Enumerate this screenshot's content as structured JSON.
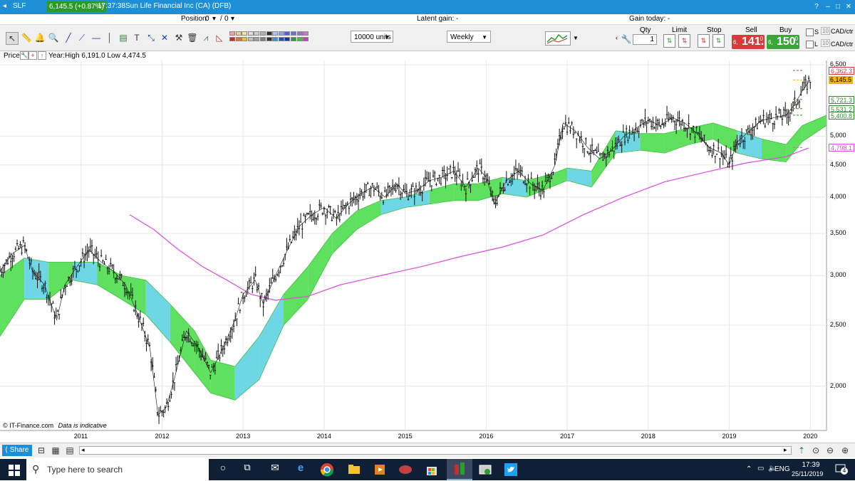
{
  "titlebar": {
    "symbol": "SLF",
    "price_change": "6,145.5 (+0.87%)",
    "time": "17:37:38",
    "instrument": "Sun Life Financial Inc (CA) (DFB)"
  },
  "info": {
    "position_label": "Position:",
    "position_value": "0",
    "position_sep": "/",
    "position_value2": "0",
    "latent_gain": "Latent gain: -",
    "gain_today": "Gain today: -"
  },
  "toolbar": {
    "units": "10000 units",
    "period": "Weekly",
    "qty_label": "Qty",
    "qty_value": "1",
    "limit_label": "Limit",
    "stop_label": "Stop",
    "sell_label": "Sell",
    "buy_label": "Buy",
    "sell_small": "6,",
    "sell_big": "141.",
    "sell_sup": "0",
    "buy_small": "6,",
    "buy_big": "150.",
    "buy_sup": "0",
    "s_label": "S",
    "l_label": "L",
    "s_qty": "10",
    "l_qty": "10",
    "ccy1": "CAD/ctr",
    "ccy2": "CAD/ctr",
    "icons": [
      "cursor-icon",
      "ruler-icon",
      "bell-icon",
      "zoom-icon",
      "line-tool-icon",
      "ray-tool-icon",
      "trend-icon",
      "vertical-line-icon",
      "horizontal-line-icon",
      "fibonacci-icon",
      "text-tool-icon",
      "arrow-tool-icon",
      "cross-tool-icon",
      "hammer-icon",
      "trash-icon",
      "pattern-tool-icon",
      "triangle-tool-icon"
    ],
    "swatches_row1": [
      "#f5a0a0",
      "#f7c5a0",
      "#f7e3a0",
      "#e0e0e0",
      "#d0d0d0",
      "#b0b0b0",
      "#303030",
      "#a0c8f0",
      "#90a0f0",
      "#5060e0",
      "#7070d0",
      "#a070d0",
      "#d070d0"
    ],
    "swatches_row2": [
      "#e02020",
      "#f07020",
      "#f0c020",
      "#c0c0c0",
      "#a0a0a0",
      "#808080",
      "#303030",
      "#4090e0",
      "#2050c0",
      "#2030a0",
      "#20a040",
      "#40c040",
      "#c040c0"
    ]
  },
  "pricelabel": {
    "title": "Price",
    "range": "Year:High 6,191.0 Low 4,474.5"
  },
  "chart_data": {
    "type": "line",
    "title": "Sun Life Financial Inc (CA) (DFB)",
    "interval": "Weekly",
    "log_scale": true,
    "grid": true,
    "ylim": [
      1700,
      6600
    ],
    "y_ticks": [
      "6,500",
      "5,000",
      "4,500",
      "4,000",
      "3,500",
      "3,000",
      "2,500",
      "2,000"
    ],
    "x_ticks": [
      "2011",
      "2012",
      "2013",
      "2014",
      "2015",
      "2016",
      "2017",
      "2018",
      "2019",
      "2020"
    ],
    "x_range": [
      2010.0,
      2020.2
    ],
    "colors": {
      "price": "#111111",
      "ma": "#e04be0",
      "cloud_bull": "#5fe05f",
      "cloud_bear": "#6fd6e6",
      "current": "#f4b400"
    },
    "price_labels": [
      {
        "text": "6,362.3",
        "value": 6362.3,
        "color": "#d63b3b"
      },
      {
        "text": "6,145.5",
        "value": 6145.5,
        "color": "#f4b400"
      },
      {
        "text": "5,721.3",
        "value": 5721.3,
        "color": "#2a8f2a"
      },
      {
        "text": "5,531.2",
        "value": 5531.2,
        "color": "#2a8f2a"
      },
      {
        "text": "5,400.8",
        "value": 5400.8,
        "color": "#2a8f2a"
      },
      {
        "text": "4,798.1",
        "value": 4798.1,
        "color": "#e04be0"
      }
    ],
    "series": [
      {
        "name": "Price",
        "points": [
          [
            2010.0,
            3050
          ],
          [
            2010.15,
            3250
          ],
          [
            2010.3,
            3350
          ],
          [
            2010.4,
            3050
          ],
          [
            2010.55,
            2900
          ],
          [
            2010.7,
            2550
          ],
          [
            2010.8,
            2900
          ],
          [
            2010.95,
            3100
          ],
          [
            2011.1,
            3300
          ],
          [
            2011.25,
            3150
          ],
          [
            2011.4,
            3050
          ],
          [
            2011.55,
            2900
          ],
          [
            2011.7,
            2600
          ],
          [
            2011.85,
            2300
          ],
          [
            2011.95,
            1800
          ],
          [
            2012.05,
            1850
          ],
          [
            2012.15,
            2050
          ],
          [
            2012.3,
            2450
          ],
          [
            2012.45,
            2300
          ],
          [
            2012.6,
            2100
          ],
          [
            2012.75,
            2300
          ],
          [
            2012.9,
            2550
          ],
          [
            2013.0,
            2800
          ],
          [
            2013.15,
            2950
          ],
          [
            2013.25,
            2700
          ],
          [
            2013.4,
            3000
          ],
          [
            2013.55,
            3300
          ],
          [
            2013.7,
            3600
          ],
          [
            2013.85,
            3750
          ],
          [
            2014.0,
            3850
          ],
          [
            2014.15,
            3700
          ],
          [
            2014.3,
            3900
          ],
          [
            2014.45,
            4050
          ],
          [
            2014.6,
            4150
          ],
          [
            2014.75,
            4000
          ],
          [
            2014.9,
            4200
          ],
          [
            2015.0,
            4050
          ],
          [
            2015.15,
            4100
          ],
          [
            2015.3,
            4250
          ],
          [
            2015.45,
            4300
          ],
          [
            2015.6,
            4400
          ],
          [
            2015.75,
            4150
          ],
          [
            2015.9,
            4450
          ],
          [
            2016.0,
            4300
          ],
          [
            2016.1,
            3900
          ],
          [
            2016.25,
            4250
          ],
          [
            2016.4,
            4400
          ],
          [
            2016.55,
            4200
          ],
          [
            2016.7,
            4100
          ],
          [
            2016.85,
            4500
          ],
          [
            2016.95,
            5250
          ],
          [
            2017.1,
            5100
          ],
          [
            2017.25,
            4800
          ],
          [
            2017.4,
            4600
          ],
          [
            2017.55,
            4750
          ],
          [
            2017.7,
            5000
          ],
          [
            2017.85,
            5150
          ],
          [
            2018.0,
            5300
          ],
          [
            2018.15,
            5200
          ],
          [
            2018.3,
            5350
          ],
          [
            2018.45,
            5250
          ],
          [
            2018.6,
            5050
          ],
          [
            2018.75,
            4800
          ],
          [
            2018.9,
            4700
          ],
          [
            2019.0,
            4500
          ],
          [
            2019.1,
            4900
          ],
          [
            2019.25,
            5100
          ],
          [
            2019.4,
            5300
          ],
          [
            2019.55,
            5350
          ],
          [
            2019.7,
            5400
          ],
          [
            2019.8,
            5600
          ],
          [
            2019.9,
            5900
          ],
          [
            2020.0,
            6150
          ]
        ]
      },
      {
        "name": "Moving average",
        "points": [
          [
            2011.6,
            3750
          ],
          [
            2011.9,
            3550
          ],
          [
            2012.2,
            3300
          ],
          [
            2012.5,
            3100
          ],
          [
            2012.8,
            2950
          ],
          [
            2013.1,
            2800
          ],
          [
            2013.4,
            2740
          ],
          [
            2013.8,
            2780
          ],
          [
            2014.2,
            2900
          ],
          [
            2014.7,
            3000
          ],
          [
            2015.2,
            3100
          ],
          [
            2015.7,
            3220
          ],
          [
            2016.2,
            3330
          ],
          [
            2016.7,
            3480
          ],
          [
            2017.2,
            3750
          ],
          [
            2017.7,
            4000
          ],
          [
            2018.2,
            4230
          ],
          [
            2018.7,
            4380
          ],
          [
            2019.2,
            4530
          ],
          [
            2019.7,
            4640
          ],
          [
            2019.98,
            4790
          ]
        ]
      },
      {
        "name": "Cloud upper",
        "points": [
          [
            2010.0,
            3000
          ],
          [
            2010.3,
            3200
          ],
          [
            2010.6,
            3150
          ],
          [
            2010.9,
            3150
          ],
          [
            2011.2,
            3150
          ],
          [
            2011.5,
            3000
          ],
          [
            2011.8,
            2950
          ],
          [
            2012.1,
            2700
          ],
          [
            2012.4,
            2450
          ],
          [
            2012.6,
            2200
          ],
          [
            2012.9,
            2150
          ],
          [
            2013.2,
            2400
          ],
          [
            2013.5,
            2800
          ],
          [
            2013.8,
            3100
          ],
          [
            2014.1,
            3500
          ],
          [
            2014.4,
            3800
          ],
          [
            2014.7,
            3950
          ],
          [
            2015.0,
            4000
          ],
          [
            2015.3,
            4100
          ],
          [
            2015.6,
            4200
          ],
          [
            2015.9,
            4200
          ],
          [
            2016.2,
            4300
          ],
          [
            2016.5,
            4250
          ],
          [
            2016.8,
            4350
          ],
          [
            2017.0,
            4450
          ],
          [
            2017.3,
            4400
          ],
          [
            2017.6,
            5100
          ],
          [
            2017.9,
            5050
          ],
          [
            2018.2,
            5050
          ],
          [
            2018.5,
            5150
          ],
          [
            2018.8,
            5250
          ],
          [
            2019.1,
            5100
          ],
          [
            2019.4,
            4950
          ],
          [
            2019.7,
            4850
          ],
          [
            2019.9,
            5200
          ],
          [
            2020.2,
            5400
          ]
        ]
      },
      {
        "name": "Cloud lower",
        "points": [
          [
            2010.0,
            2400
          ],
          [
            2010.3,
            2750
          ],
          [
            2010.6,
            2750
          ],
          [
            2010.9,
            2950
          ],
          [
            2011.2,
            2900
          ],
          [
            2011.5,
            2750
          ],
          [
            2011.8,
            2600
          ],
          [
            2012.1,
            2350
          ],
          [
            2012.4,
            2100
          ],
          [
            2012.6,
            1950
          ],
          [
            2012.9,
            1900
          ],
          [
            2013.2,
            2050
          ],
          [
            2013.5,
            2500
          ],
          [
            2013.8,
            2750
          ],
          [
            2014.1,
            3250
          ],
          [
            2014.4,
            3550
          ],
          [
            2014.7,
            3750
          ],
          [
            2015.0,
            3850
          ],
          [
            2015.3,
            3900
          ],
          [
            2015.6,
            3950
          ],
          [
            2015.9,
            3950
          ],
          [
            2016.2,
            4050
          ],
          [
            2016.5,
            4000
          ],
          [
            2016.8,
            4150
          ],
          [
            2017.0,
            4250
          ],
          [
            2017.3,
            4150
          ],
          [
            2017.6,
            4700
          ],
          [
            2017.9,
            4750
          ],
          [
            2018.2,
            4700
          ],
          [
            2018.5,
            4850
          ],
          [
            2018.8,
            4950
          ],
          [
            2019.1,
            4700
          ],
          [
            2019.4,
            4600
          ],
          [
            2019.7,
            4550
          ],
          [
            2019.9,
            4900
          ],
          [
            2020.2,
            5200
          ]
        ]
      }
    ]
  },
  "watermark": {
    "source": "© IT-Finance.com",
    "note": "Data is indicative"
  },
  "scrollrow": {
    "share": "Share"
  },
  "taskbar": {
    "search_placeholder": "Type here to search",
    "lang": "ENG",
    "time": "17:39",
    "date": "25/11/2019",
    "notifications": "4"
  }
}
